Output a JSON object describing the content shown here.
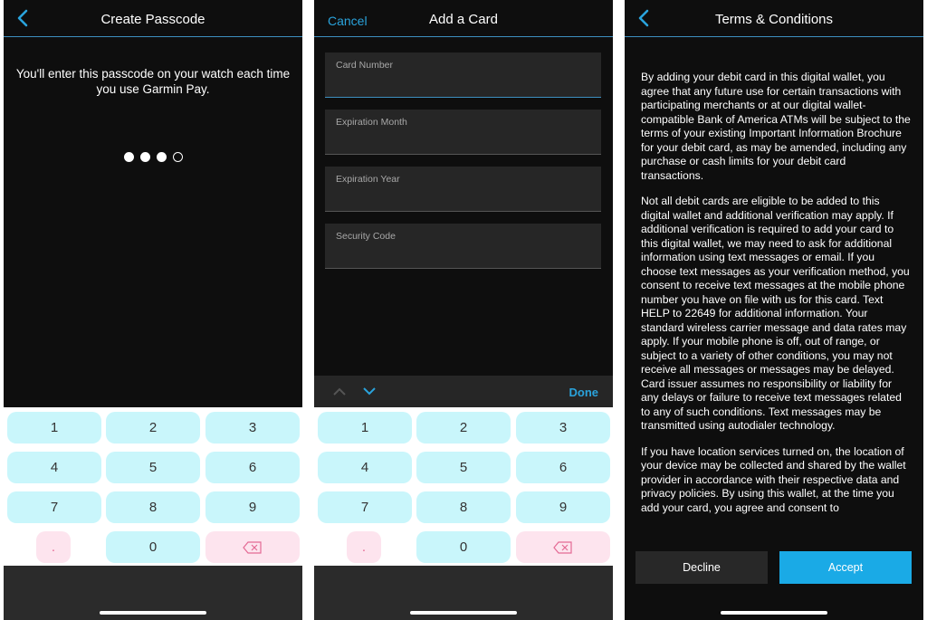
{
  "passcode": {
    "title": "Create Passcode",
    "message": "You'll enter this passcode on your watch each time you use Garmin Pay.",
    "digits_total": 4,
    "digits_filled": 3
  },
  "keypad": {
    "keys": [
      "1",
      "2",
      "3",
      "4",
      "5",
      "6",
      "7",
      "8",
      "9",
      "0"
    ],
    "decimal": "."
  },
  "add_card": {
    "cancel": "Cancel",
    "title": "Add a Card",
    "fields": [
      "Card Number",
      "Expiration Month",
      "Expiration Year",
      "Security Code"
    ],
    "done": "Done"
  },
  "terms": {
    "title": "Terms & Conditions",
    "paragraphs": [
      "By adding your debit card in this digital wallet, you agree that any future use for certain transactions with participating merchants or at our digital wallet-compatible Bank of America ATMs will be subject to the terms of your existing Important Information Brochure for your debit card, as may be amended, including any purchase or cash limits for your debit card transactions.",
      "Not all debit cards are eligible to be added to this digital wallet and additional verification may apply. If additional verification is required to add your card to this digital wallet, we may need to ask for additional information using text messages or email. If you choose text messages as your verification method, you consent to receive text messages at the mobile phone number you have on file with us for this card. Text HELP to 22649 for additional information. Your standard wireless carrier message and data rates may apply. If your mobile phone is off, out of range, or subject to a variety of other conditions, you may not receive all messages or messages may be delayed. Card issuer assumes no responsibility or liability for any delays or failure to receive text messages related to any of such conditions. Text messages may be transmitted using autodialer technology.",
      "If you have location services turned on, the location of your device may be collected and shared by the wallet provider in accordance with their respective data and privacy policies. By using this wallet, at the time you add your card, you agree and consent to"
    ],
    "decline": "Decline",
    "accept": "Accept"
  },
  "colors": {
    "accent": "#2aa3dc",
    "accept": "#1aaae6",
    "key": "#c9f6fb",
    "key_pink": "#fde4ee"
  }
}
